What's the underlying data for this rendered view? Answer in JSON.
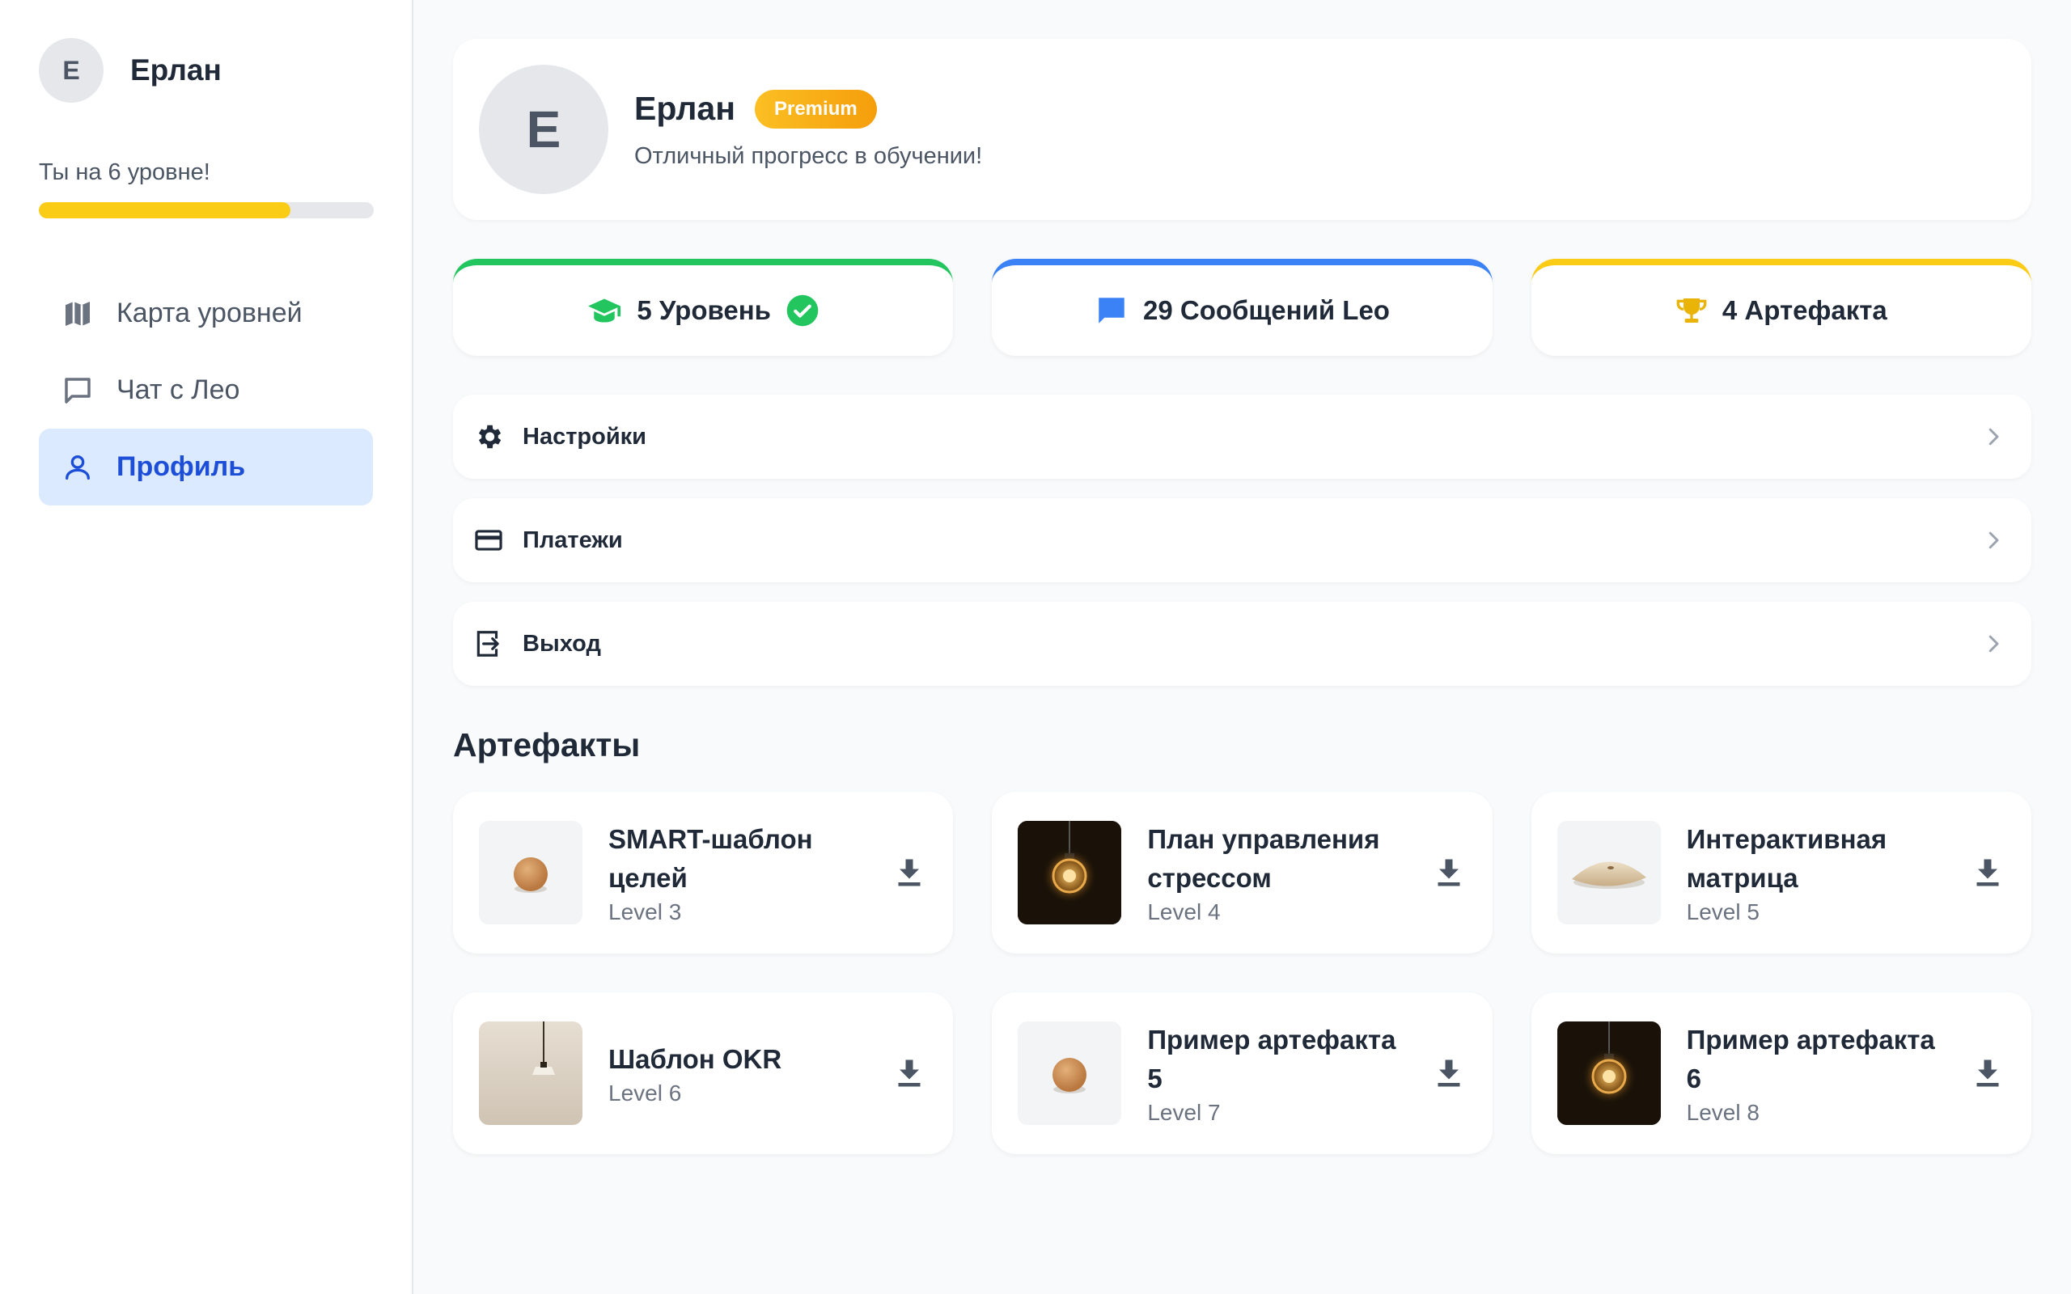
{
  "sidebar": {
    "avatar_initial": "E",
    "user_name": "Ерлан",
    "level_text": "Ты на 6 уровне!",
    "progress_fraction": 0.75,
    "items": [
      {
        "label": "Карта уровней",
        "icon": "map-icon"
      },
      {
        "label": "Чат с Лео",
        "icon": "chat-icon"
      },
      {
        "label": "Профиль",
        "icon": "user-icon"
      }
    ]
  },
  "profile": {
    "avatar_initial": "E",
    "name": "Ерлан",
    "badge": "Premium",
    "subtitle": "Отличный прогресс в обучении!"
  },
  "stats": [
    {
      "label": "5 Уровень",
      "color": "#22c55e",
      "icon": "graduation-cap-icon"
    },
    {
      "label": "29 Сообщений Leo",
      "color": "#3b82f6",
      "icon": "message-icon"
    },
    {
      "label": "4 Артефакта",
      "color": "#facc15",
      "icon": "trophy-icon"
    }
  ],
  "menu": [
    {
      "label": "Настройки",
      "icon": "gear-icon"
    },
    {
      "label": "Платежи",
      "icon": "credit-card-icon"
    },
    {
      "label": "Выход",
      "icon": "logout-icon"
    }
  ],
  "artifacts_title": "Артефакты",
  "artifacts": [
    {
      "title": "SMART-шаблон целей",
      "level": "Level 3",
      "thumb": "wood-ball"
    },
    {
      "title": "План управления стрессом",
      "level": "Level 4",
      "thumb": "bulb"
    },
    {
      "title": "Интерактивная матрица",
      "level": "Level 5",
      "thumb": "stone"
    },
    {
      "title": "Шаблон OKR",
      "level": "Level 6",
      "thumb": "lamp"
    },
    {
      "title": "Пример артефакта 5",
      "level": "Level 7",
      "thumb": "wood-ball"
    },
    {
      "title": "Пример артефакта 6",
      "level": "Level 8",
      "thumb": "bulb"
    }
  ]
}
